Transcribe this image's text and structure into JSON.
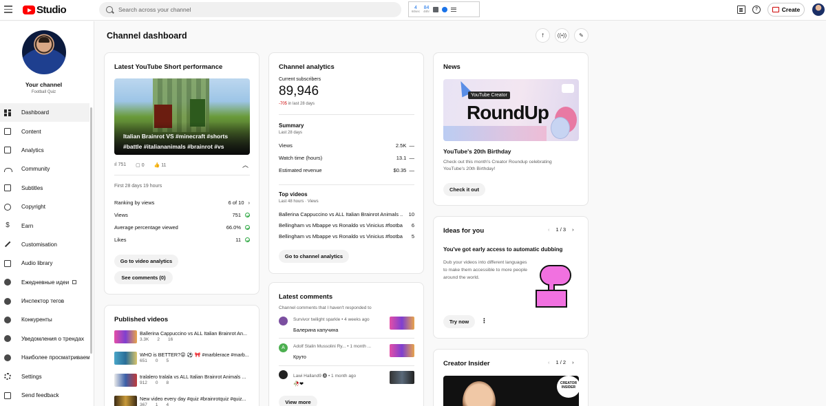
{
  "app": {
    "title": "Studio"
  },
  "search": {
    "placeholder": "Search across your channel"
  },
  "extension": {
    "a_num": "4",
    "a_sub": "60sec",
    "b_num": "84",
    "b_sub": "48hr"
  },
  "header": {
    "create_label": "Create",
    "help_label": "?"
  },
  "sidebar": {
    "channel_name": "Your channel",
    "channel_sub": "Football Quiz",
    "items": [
      {
        "label": "Dashboard",
        "icon": "dashboard-icon"
      },
      {
        "label": "Content",
        "icon": "content-icon"
      },
      {
        "label": "Analytics",
        "icon": "analytics-icon"
      },
      {
        "label": "Community",
        "icon": "community-icon"
      },
      {
        "label": "Subtitles",
        "icon": "subtitles-icon"
      },
      {
        "label": "Copyright",
        "icon": "copyright-icon"
      },
      {
        "label": "Earn",
        "icon": "earn-icon"
      },
      {
        "label": "Customisation",
        "icon": "customisation-icon"
      },
      {
        "label": "Audio library",
        "icon": "audio-library-icon"
      },
      {
        "label": "Ежедневные идеи",
        "icon": "ideas-icon"
      },
      {
        "label": "Инспектор тегов",
        "icon": "tags-icon"
      },
      {
        "label": "Конкуренты",
        "icon": "competitors-icon"
      },
      {
        "label": "Уведомления о трендах",
        "icon": "trends-icon"
      },
      {
        "label": "Наиболее просматриваемые",
        "icon": "most-viewed-icon"
      },
      {
        "label": "Settings",
        "icon": "settings-icon"
      },
      {
        "label": "Send feedback",
        "icon": "feedback-icon"
      }
    ]
  },
  "main": {
    "title": "Channel dashboard"
  },
  "short_card": {
    "title": "Latest YouTube Short performance",
    "thumb_caption": "Italian Brainrot VS #minecraft #shorts #battle #italiananimals #brainrot #vs",
    "views": "751",
    "comments": "0",
    "likes": "11",
    "period": "First 28 days 19 hours",
    "ranking_label": "Ranking by views",
    "ranking_value": "6 of 10",
    "metrics": [
      {
        "label": "Views",
        "value": "751"
      },
      {
        "label": "Average percentage viewed",
        "value": "66.0%"
      },
      {
        "label": "Likes",
        "value": "11"
      }
    ],
    "btn_analytics": "Go to video analytics",
    "btn_comments": "See comments (0)"
  },
  "published_card": {
    "title": "Published videos",
    "videos": [
      {
        "title": "Ballerina Cappuccino vs ALL Italian Brainrot An...",
        "views": "3.3K",
        "comments": "2",
        "likes": "16"
      },
      {
        "title": "WHO is BETTER?😝 ⚽ 🎀 #marblerace #marb...",
        "views": "651",
        "comments": "0",
        "likes": "5"
      },
      {
        "title": "tralalero tralala vs ALL Italian Brainrot Animals ...",
        "views": "912",
        "comments": "0",
        "likes": "8"
      },
      {
        "title": "New video every day #quiz #brainrotquiz #quiz...",
        "views": "367",
        "comments": "1",
        "likes": "4"
      }
    ]
  },
  "analytics_card": {
    "title": "Channel analytics",
    "subs_label": "Current subscribers",
    "subs_value": "89,946",
    "subs_change": "-705",
    "subs_change_suffix": " in last 28 days",
    "summary_title": "Summary",
    "summary_period": "Last 28 days",
    "summary": [
      {
        "label": "Views",
        "value": "2.5K"
      },
      {
        "label": "Watch time (hours)",
        "value": "13.1"
      },
      {
        "label": "Estimated revenue",
        "value": "$0.35"
      }
    ],
    "top_title": "Top videos",
    "top_period": "Last 48 hours · Views",
    "top": [
      {
        "title": "Ballerina Cappuccino vs ALL Italian Brainrot Animals ...",
        "value": "10"
      },
      {
        "title": "Bellingham vs Mbappe vs Ronaldo vs Vinicius #footba...",
        "value": "6"
      },
      {
        "title": "Bellingham vs Mbappe vs Ronaldo vs Vinicius #footba...",
        "value": "5"
      }
    ],
    "btn": "Go to channel analytics"
  },
  "comments_card": {
    "title": "Latest comments",
    "subtitle": "Channel comments that I haven't responded to",
    "comments": [
      {
        "author": "Survivor twilight sparkle • 4 weeks ago",
        "text": "Балерина капучина",
        "avatar": "S"
      },
      {
        "author": "Adolf Stalin Mussolini Ry... • 1 month ...",
        "text": "Круто",
        "avatar": "A"
      },
      {
        "author": "Lawi Halland9 🅐 • 1 month ago",
        "text": "🥀❤",
        "avatar": "L"
      }
    ],
    "btn": "View more"
  },
  "news_card": {
    "title": "News",
    "banner_tag": "YouTube Creator",
    "banner_title": "RoundUp",
    "headline": "YouTube's 20th Birthday",
    "body": "Check out this month's Creator Roundup celebrating YouTube's 20th Birthday!",
    "btn": "Check it out"
  },
  "ideas_card": {
    "title": "Ideas for you",
    "pager": "1 / 3",
    "headline": "You've got early access to automatic dubbing",
    "body": "Dub your videos into different languages to make them accessible to more people around the world.",
    "btn": "Try now"
  },
  "insider_card": {
    "title": "Creator Insider",
    "pager": "1 / 2",
    "badge": "CREATOR INSIDER"
  }
}
